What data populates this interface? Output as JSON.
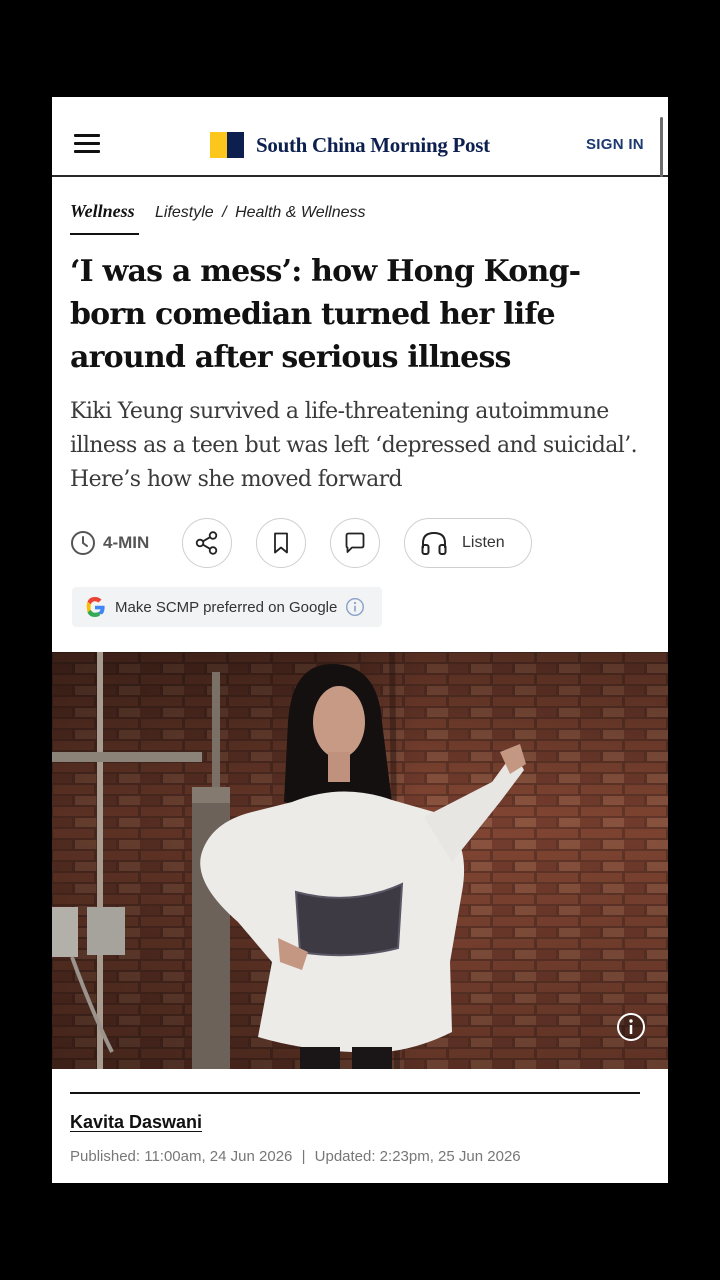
{
  "header": {
    "logo_text": "South China Morning Post",
    "signin_label": "SIGN IN",
    "logo_colors": {
      "yellow": "#fdc61c",
      "navy": "#0d1f4f"
    }
  },
  "breadcrumb": {
    "section": "Wellness",
    "path": [
      "Lifestyle",
      "Health & Wellness"
    ],
    "separator": "/"
  },
  "article": {
    "headline": "‘I was a mess’: how Hong Kong-born comedian turned her life around after serious illness",
    "subhead": "Kiki Yeung survived a life-threatening autoimmune illness as a teen but was left ‘depressed and suicidal’. Here’s how she moved forward",
    "read_time": "4-MIN",
    "listen_label": "Listen",
    "google_pref_label": "Make SCMP preferred on Google",
    "author": "Kavita Daswani",
    "published": "Published: 11:00am, 24 Jun 2026",
    "updated": "Updated: 2:23pm, 25 Jun 2026"
  },
  "icons": {
    "menu": "hamburger-menu-icon",
    "clock": "clock-icon",
    "share": "share-icon",
    "bookmark": "bookmark-icon",
    "comment": "comment-icon",
    "listen": "headphones-icon",
    "google": "google-g-icon",
    "info": "info-icon"
  }
}
